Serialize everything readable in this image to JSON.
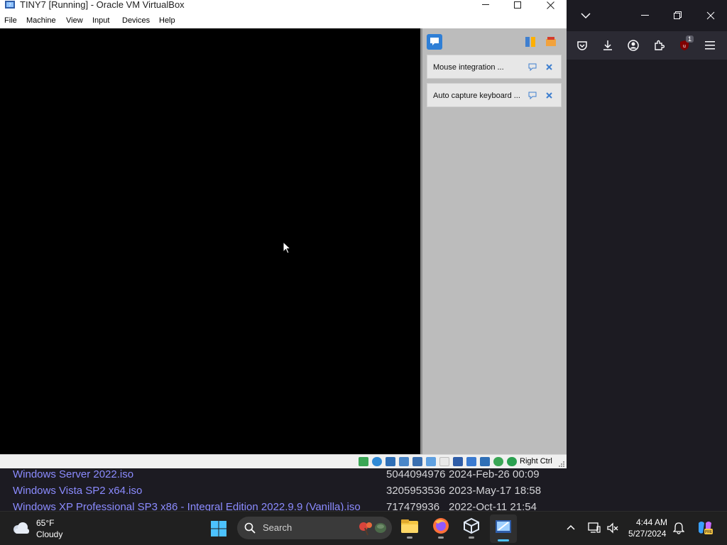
{
  "virtualbox": {
    "title": "TINY7 [Running] - Oracle VM VirtualBox",
    "menu": [
      "File",
      "Machine",
      "View",
      "Input",
      "Devices",
      "Help"
    ],
    "notifications": [
      {
        "text": "Mouse integration ..."
      },
      {
        "text": "Auto capture keyboard ..."
      }
    ],
    "status": {
      "host_key": "Right Ctrl"
    }
  },
  "firefox": {
    "extension_badge": "1"
  },
  "file_listing": [
    {
      "name": "Windows Server 2022.iso",
      "size": "5044094976",
      "date": "2024-Feb-26 00:09"
    },
    {
      "name": "Windows Vista SP2 x64.iso",
      "size": "3205953536",
      "date": "2023-May-17 18:58"
    },
    {
      "name": "Windows XP Professional SP3 x86 - Integral Edition 2022.9.9 (Vanilla).iso",
      "size": "717479936",
      "date": "2022-Oct-11 21:54"
    }
  ],
  "taskbar": {
    "weather": {
      "temp": "65°F",
      "condition": "Cloudy"
    },
    "search_placeholder": "Search",
    "clock": {
      "time": "4:44 AM",
      "date": "5/27/2024"
    }
  },
  "colors": {
    "link": "#8b8bff",
    "vm_screen": "#000000",
    "notif_panel": "#bcbcbc",
    "taskbar": "#202020"
  }
}
